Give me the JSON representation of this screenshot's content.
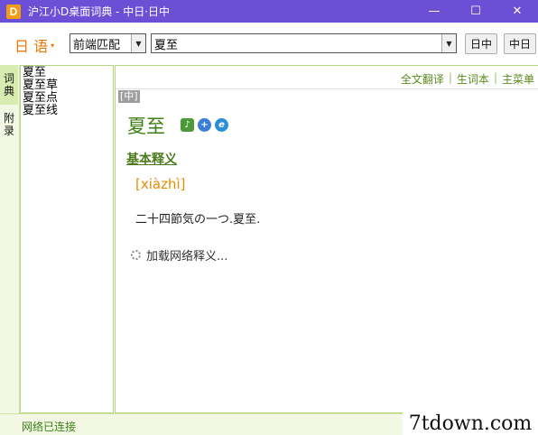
{
  "window": {
    "title": "沪江小D桌面词典 - 中日·日中",
    "logo_letter": "D",
    "minimize_glyph": "—",
    "maximize_glyph": "☐",
    "close_glyph": "✕"
  },
  "toolbar": {
    "language_label": "日 语",
    "language_arrow": "▾",
    "match_mode": "前端匹配",
    "search_value": "夏至",
    "btn_jc": "日中",
    "btn_cj": "中日",
    "dropdown_glyph": "▼"
  },
  "side_tabs": [
    {
      "label": "词典",
      "active": true
    },
    {
      "label": "附录",
      "active": false
    }
  ],
  "word_list": [
    "夏至",
    "夏至草",
    "夏至点",
    "夏至线"
  ],
  "content": {
    "links": [
      "全文翻译",
      "生词本",
      "主菜单"
    ],
    "link_sep": "|",
    "lang_badge": "[中]",
    "headword": "夏至",
    "section_title": "基本释义",
    "pinyin": "[xiàzhì]",
    "definition": "二十四節気の一つ.夏至.",
    "loading_text": "加载网络释义..."
  },
  "status": {
    "text": "网络已连接"
  },
  "watermark": "7tdown.com",
  "colors": {
    "titlebar": "#6b4fd4",
    "accent_green": "#3d7f14",
    "pinyin_orange": "#e88b00",
    "lang_orange": "#f07400"
  }
}
